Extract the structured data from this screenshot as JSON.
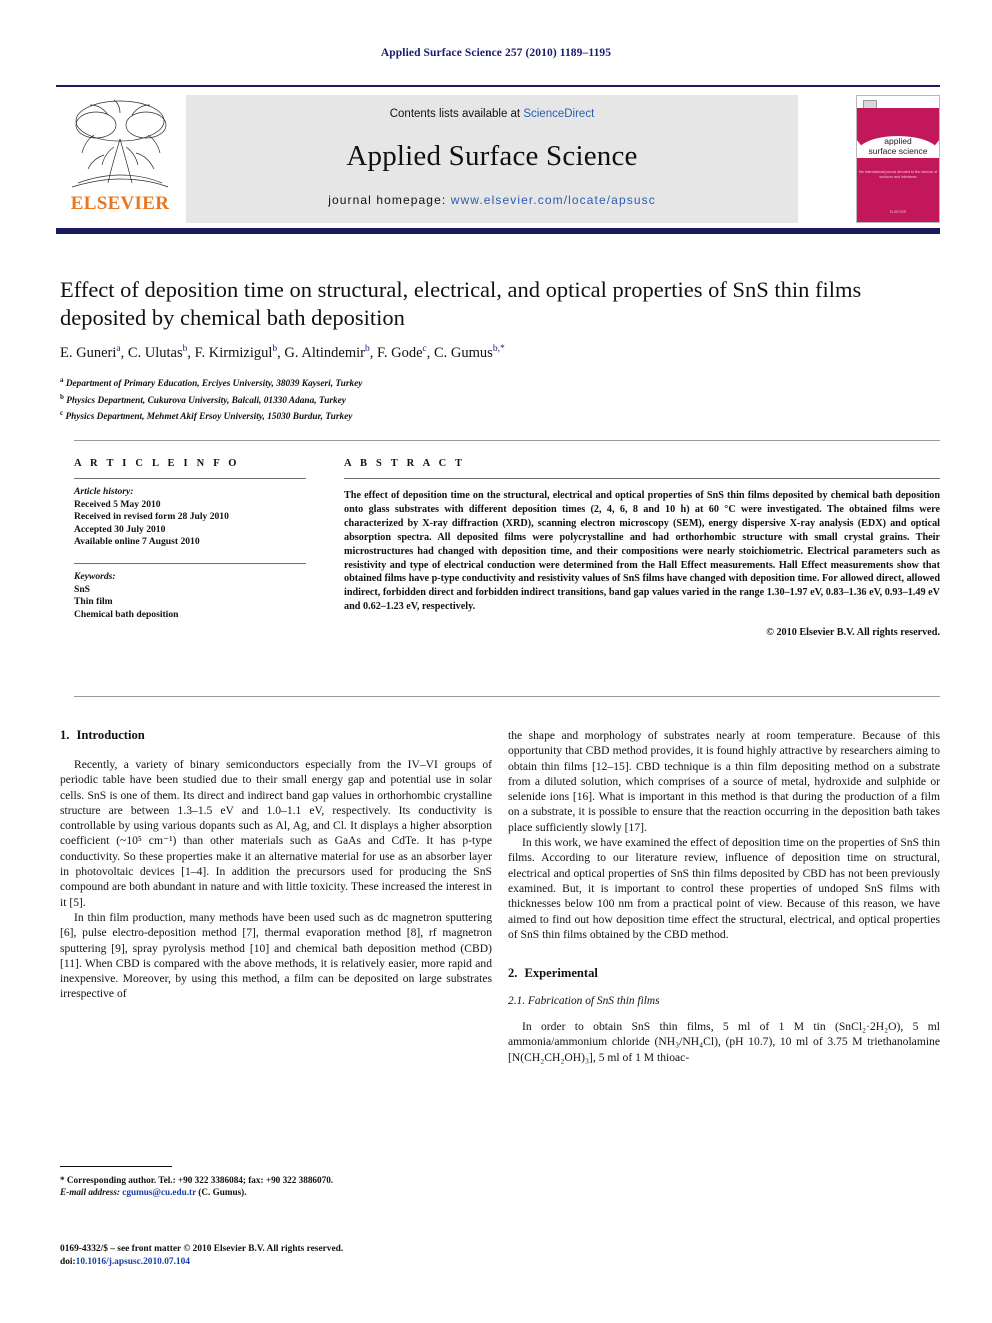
{
  "running_head": "Applied Surface Science 257 (2010) 1189–1195",
  "masthead": {
    "contents_prefix": "Contents lists available at ",
    "sciencedirect": "ScienceDirect",
    "journal_name": "Applied Surface Science",
    "homepage_label": "journal homepage: ",
    "homepage_url": "www.elsevier.com/locate/apsusc",
    "publisher": "ELSEVIER",
    "accent_orange": "#e87722",
    "accent_blue": "#2a5db0",
    "rule_color": "#1a1a5e",
    "cover": {
      "title_line1": "applied",
      "title_line2": "surface science",
      "subtitle": "the international journal devoted to\nthe science of surfaces and interfaces",
      "footer": "ELSEVIER",
      "color": "#c2185b"
    }
  },
  "article": {
    "title": "Effect of deposition time on structural, electrical, and optical properties of SnS thin films deposited by chemical bath deposition",
    "authors": [
      {
        "name": "E. Guneri",
        "marks": "a"
      },
      {
        "name": "C. Ulutas",
        "marks": "b"
      },
      {
        "name": "F. Kirmizigul",
        "marks": "b"
      },
      {
        "name": "G. Altindemir",
        "marks": "b"
      },
      {
        "name": "F. Gode",
        "marks": "c"
      },
      {
        "name": "C. Gumus",
        "marks": "b,*"
      }
    ],
    "affiliations": [
      {
        "mark": "a",
        "text": "Department of Primary Education, Erciyes University, 38039 Kayseri, Turkey"
      },
      {
        "mark": "b",
        "text": "Physics Department, Cukurova University, Balcali, 01330 Adana, Turkey"
      },
      {
        "mark": "c",
        "text": "Physics Department, Mehmet Akif Ersoy University, 15030 Burdur, Turkey"
      }
    ]
  },
  "article_info": {
    "heading": "A R T I C L E   I N F O",
    "history_label": "Article history:",
    "history": [
      "Received 5 May 2010",
      "Received in revised form 28 July 2010",
      "Accepted 30 July 2010",
      "Available online 7 August 2010"
    ],
    "keywords_label": "Keywords:",
    "keywords": [
      "SnS",
      "Thin film",
      "Chemical bath deposition"
    ]
  },
  "abstract": {
    "heading": "A B S T R A C T",
    "text": "The effect of deposition time on the structural, electrical and optical properties of SnS thin films deposited by chemical bath deposition onto glass substrates with different deposition times (2, 4, 6, 8 and 10 h) at 60 °C were investigated. The obtained films were characterized by X-ray diffraction (XRD), scanning electron microscopy (SEM), energy dispersive X-ray analysis (EDX) and optical absorption spectra. All deposited films were polycrystalline and had orthorhombic structure with small crystal grains. Their microstructures had changed with deposition time, and their compositions were nearly stoichiometric. Electrical parameters such as resistivity and type of electrical conduction were determined from the Hall Effect measurements. Hall Effect measurements show that obtained films have p-type conductivity and resistivity values of SnS films have changed with deposition time. For allowed direct, allowed indirect, forbidden direct and forbidden indirect transitions, band gap values varied in the range 1.30–1.97 eV, 0.83–1.36 eV, 0.93–1.49 eV and 0.62–1.23 eV, respectively.",
    "copyright": "© 2010 Elsevier B.V. All rights reserved."
  },
  "body": {
    "intro_heading_num": "1.",
    "intro_heading": "Introduction",
    "experimental_heading_num": "2.",
    "experimental_heading": "Experimental",
    "sub_heading": "2.1.  Fabrication of SnS thin films",
    "para_left_1": "Recently, a variety of binary semiconductors especially from the IV–VI groups of periodic table have been studied due to their small energy gap and potential use in solar cells. SnS is one of them. Its direct and indirect band gap values in orthorhombic crystalline structure are between 1.3–1.5 eV and 1.0–1.1 eV, respectively. Its conductivity is controllable by using various dopants such as Al, Ag, and Cl. It displays a higher absorption coefficient (~10⁵ cm⁻¹) than other materials such as GaAs and CdTe. It has p-type conductivity. So these properties make it an alternative material for use as an absorber layer in photovoltaic devices [1–4]. In addition the precursors used for producing the SnS compound are both abundant in nature and with little toxicity. These increased the interest in it [5].",
    "para_left_2": "In thin film production, many methods have been used such as dc magnetron sputtering [6], pulse electro-deposition method [7], thermal evaporation method [8], rf magnetron sputtering [9], spray pyrolysis method [10] and chemical bath deposition method (CBD) [11]. When CBD is compared with the above methods, it is relatively easier, more rapid and inexpensive. Moreover, by using this method, a film can be deposited on large substrates irrespective of",
    "para_right_1": "the shape and morphology of substrates nearly at room temperature. Because of this opportunity that CBD method provides, it is found highly attractive by researchers aiming to obtain thin films [12–15]. CBD technique is a thin film depositing method on a substrate from a diluted solution, which comprises of a source of metal, hydroxide and sulphide or selenide ions [16]. What is important in this method is that during the production of a film on a substrate, it is possible to ensure that the reaction occurring in the deposition bath takes place sufficiently slowly [17].",
    "para_right_2": "In this work, we have examined the effect of deposition time on the properties of SnS thin films. According to our literature review, influence of deposition time on structural, electrical and optical properties of SnS thin films deposited by CBD has not been previously examined. But, it is important to control these properties of undoped SnS films with thicknesses below 100 nm from a practical point of view. Because of this reason, we have aimed to find out how deposition time effect the structural, electrical, and optical properties of SnS thin films obtained by the CBD method.",
    "para_right_3": "In order to obtain SnS thin films, 5 ml of 1 M tin (SnCl₂·2H₂O), 5 ml ammonia/ammonium chloride (NH₃/NH₄Cl), (pH 10.7), 10 ml of 3.75 M triethanolamine [N(CH₂CH₂OH)₃], 5 ml of 1 M thioac-"
  },
  "footnotes": {
    "corresponding": "* Corresponding author. Tel.: +90 322 3386084; fax: +90 322 3886070.",
    "email_label": "E-mail address:",
    "email": "cgumus@cu.edu.tr",
    "email_owner": "(C. Gumus).",
    "imprint": "0169-4332/$ – see front matter © 2010 Elsevier B.V. All rights reserved.",
    "doi_label": "doi:",
    "doi": "10.1016/j.apsusc.2010.07.104"
  }
}
